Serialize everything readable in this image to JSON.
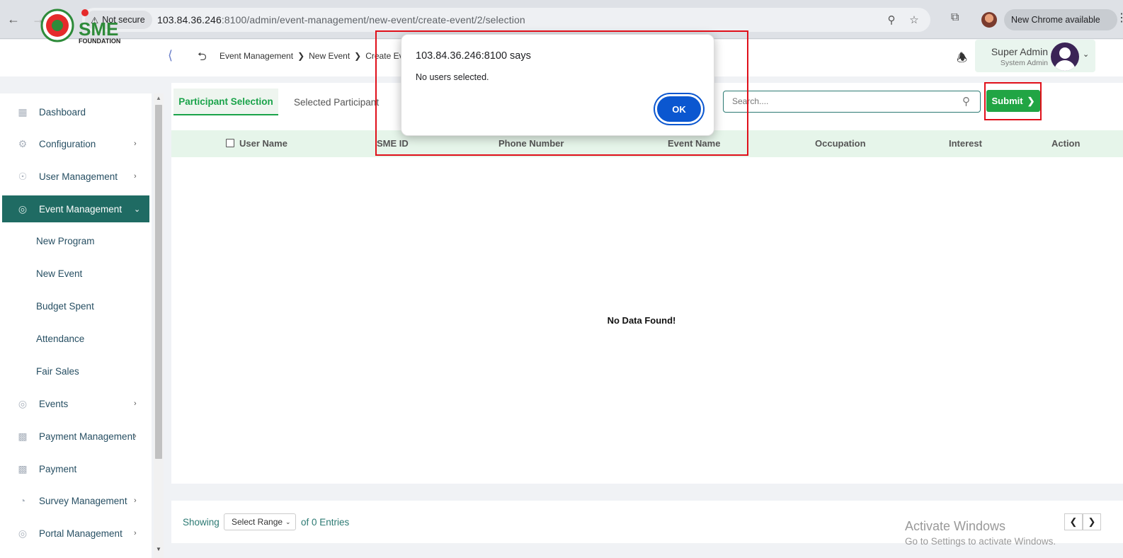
{
  "browser": {
    "security_label": "Not secure",
    "url_host": "103.84.36.246",
    "url_rest": ":8100/admin/event-management/new-event/create-event/2/selection",
    "update_label": "New Chrome available",
    "icons": [
      "back-icon",
      "forward-icon",
      "reload-icon",
      "warning-icon",
      "zoom-icon",
      "star-icon",
      "extensions-icon",
      "menu-icon"
    ]
  },
  "header": {
    "logo_text": "SME",
    "logo_subtext": "FOUNDATION",
    "breadcrumbs": [
      "Event Management",
      "New Event",
      "Create Ever"
    ],
    "user_name": "Super Admin",
    "user_role": "System Admin"
  },
  "sidebar": {
    "items": [
      {
        "label": "Dashboard",
        "icon": "grid-icon",
        "has_chevron": false
      },
      {
        "label": "Configuration",
        "icon": "config-icon",
        "has_chevron": true
      },
      {
        "label": "User Management",
        "icon": "user-shield-icon",
        "has_chevron": true
      },
      {
        "label": "Event Management",
        "icon": "lock-circle-icon",
        "has_chevron": true,
        "active": true
      },
      {
        "label": "Events",
        "icon": "lock-circle-icon",
        "has_chevron": true
      },
      {
        "label": "Payment Management",
        "icon": "money-icon",
        "has_chevron": true
      },
      {
        "label": "Payment",
        "icon": "money-icon",
        "has_chevron": false
      },
      {
        "label": "Survey Management",
        "icon": "pie-icon",
        "has_chevron": true
      },
      {
        "label": "Portal Management",
        "icon": "lock-circle-icon",
        "has_chevron": true
      }
    ],
    "sub_items": [
      "New Program",
      "New Event",
      "Budget Spent",
      "Attendance",
      "Fair Sales"
    ]
  },
  "main": {
    "tabs": [
      "Participant Selection",
      "Selected Participant"
    ],
    "search_placeholder": "Search....",
    "submit_label": "Submit",
    "columns": [
      "User Name",
      "SME ID",
      "Phone Number",
      "Event Name",
      "Occupation",
      "Interest",
      "Action"
    ],
    "empty_message": "No Data Found!"
  },
  "footer": {
    "showing_label": "Showing",
    "range_label": "Select Range",
    "entries_label": "of 0 Entries"
  },
  "os_watermark": {
    "title": "Activate Windows",
    "subtitle": "Go to Settings to activate Windows."
  },
  "dialog": {
    "title": "103.84.36.246:8100 says",
    "message": "No users selected.",
    "ok_label": "OK"
  },
  "colors": {
    "primary_teal": "#1f6b63",
    "accent_green": "#21a544",
    "dialog_blue": "#0b57d0",
    "annotation_red": "#e0101a"
  }
}
